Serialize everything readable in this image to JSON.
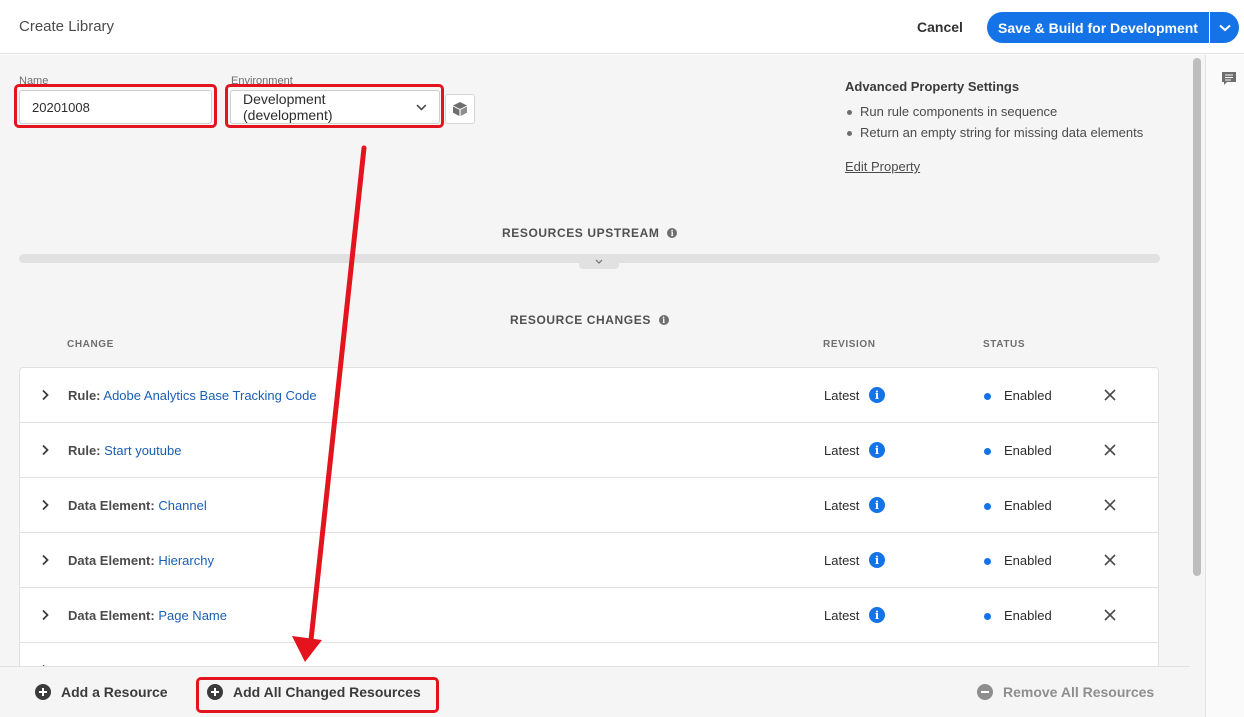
{
  "header": {
    "title": "Create Library",
    "cancel_label": "Cancel",
    "save_label": "Save & Build for Development"
  },
  "form": {
    "name_label": "Name",
    "name_value": "20201008",
    "environment_label": "Environment",
    "environment_value": "Development (development)"
  },
  "advanced": {
    "title": "Advanced Property Settings",
    "items": [
      "Run rule components in sequence",
      "Return an empty string for missing data elements"
    ],
    "edit_link": "Edit Property"
  },
  "sections": {
    "upstream": "RESOURCES UPSTREAM",
    "changes": "RESOURCE CHANGES"
  },
  "columns": {
    "change": "CHANGE",
    "revision": "REVISION",
    "status": "STATUS"
  },
  "rows": [
    {
      "type": "Rule:",
      "name": "Adobe Analytics Base Tracking Code",
      "revision": "Latest",
      "status": "Enabled"
    },
    {
      "type": "Rule:",
      "name": "Start youtube",
      "revision": "Latest",
      "status": "Enabled"
    },
    {
      "type": "Data Element:",
      "name": "Channel",
      "revision": "Latest",
      "status": "Enabled"
    },
    {
      "type": "Data Element:",
      "name": "Hierarchy",
      "revision": "Latest",
      "status": "Enabled"
    },
    {
      "type": "Data Element:",
      "name": "Page Name",
      "revision": "Latest",
      "status": "Enabled"
    }
  ],
  "footer": {
    "add_resource": "Add a Resource",
    "add_all_changed": "Add All Changed Resources",
    "remove_all": "Remove All Resources"
  },
  "colors": {
    "accent": "#1473e6",
    "highlight": "#e4141e",
    "link": "#1a5fb4"
  },
  "icons": {
    "chevron": "chevron-right-icon",
    "info": "info-icon",
    "remove": "close-icon",
    "package": "package-icon",
    "comment": "comment-icon"
  }
}
